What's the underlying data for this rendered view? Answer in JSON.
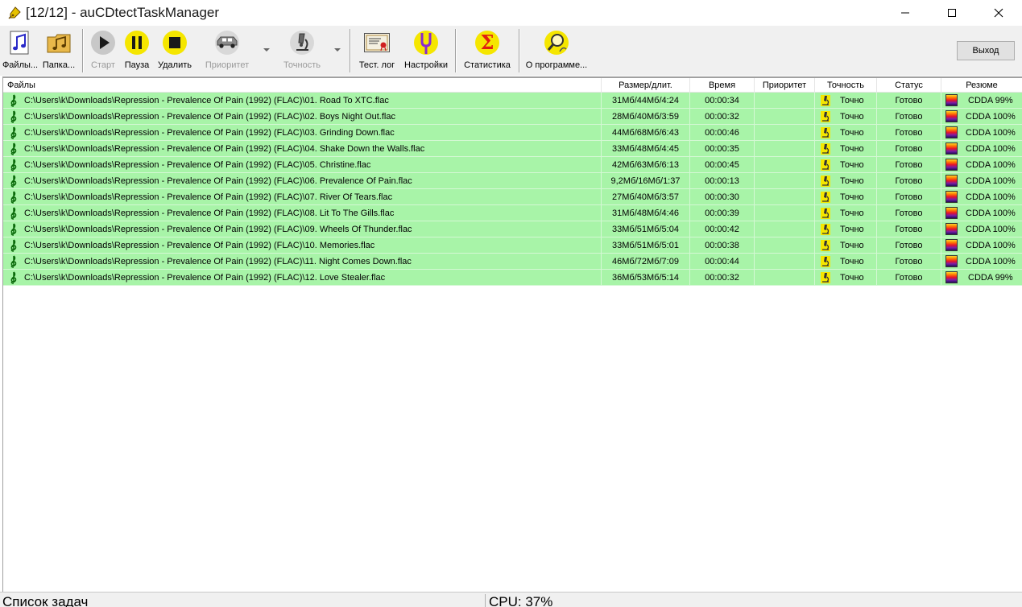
{
  "window": {
    "title": "[12/12] - auCDtectTaskManager"
  },
  "toolbar": {
    "files": "Файлы...",
    "folder": "Папка...",
    "start": "Старт",
    "pause": "Пауза",
    "delete": "Удалить",
    "priority": "Приоритет",
    "accuracy": "Точность",
    "test_log": "Тест. лог",
    "settings": "Настройки",
    "statistics": "Статистика",
    "about": "О программе...",
    "exit": "Выход"
  },
  "columns": {
    "files": "Файлы",
    "size": "Размер/длит.",
    "time": "Время",
    "priority": "Приоритет",
    "accuracy": "Точность",
    "status": "Статус",
    "summary": "Резюме"
  },
  "rows": [
    {
      "file": "C:\\Users\\k\\Downloads\\Repression - Prevalence Of Pain (1992) (FLAC)\\01. Road To XTC.flac",
      "size": "31Мб/44Мб/4:24",
      "time": "00:00:34",
      "priority": "",
      "accuracy": "Точно",
      "status": "Готово",
      "summary": "CDDA 99%"
    },
    {
      "file": "C:\\Users\\k\\Downloads\\Repression - Prevalence Of Pain (1992) (FLAC)\\02. Boys Night Out.flac",
      "size": "28Мб/40Мб/3:59",
      "time": "00:00:32",
      "priority": "",
      "accuracy": "Точно",
      "status": "Готово",
      "summary": "CDDA 100%"
    },
    {
      "file": "C:\\Users\\k\\Downloads\\Repression - Prevalence Of Pain (1992) (FLAC)\\03. Grinding Down.flac",
      "size": "44Мб/68Мб/6:43",
      "time": "00:00:46",
      "priority": "",
      "accuracy": "Точно",
      "status": "Готово",
      "summary": "CDDA 100%"
    },
    {
      "file": "C:\\Users\\k\\Downloads\\Repression - Prevalence Of Pain (1992) (FLAC)\\04. Shake Down the Walls.flac",
      "size": "33Мб/48Мб/4:45",
      "time": "00:00:35",
      "priority": "",
      "accuracy": "Точно",
      "status": "Готово",
      "summary": "CDDA 100%"
    },
    {
      "file": "C:\\Users\\k\\Downloads\\Repression - Prevalence Of Pain (1992) (FLAC)\\05. Christine.flac",
      "size": "42Мб/63Мб/6:13",
      "time": "00:00:45",
      "priority": "",
      "accuracy": "Точно",
      "status": "Готово",
      "summary": "CDDA 100%"
    },
    {
      "file": "C:\\Users\\k\\Downloads\\Repression - Prevalence Of Pain (1992) (FLAC)\\06. Prevalence Of Pain.flac",
      "size": "9,2Мб/16Мб/1:37",
      "time": "00:00:13",
      "priority": "",
      "accuracy": "Точно",
      "status": "Готово",
      "summary": "CDDA 100%"
    },
    {
      "file": "C:\\Users\\k\\Downloads\\Repression - Prevalence Of Pain (1992) (FLAC)\\07. River Of Tears.flac",
      "size": "27Мб/40Мб/3:57",
      "time": "00:00:30",
      "priority": "",
      "accuracy": "Точно",
      "status": "Готово",
      "summary": "CDDA 100%"
    },
    {
      "file": "C:\\Users\\k\\Downloads\\Repression - Prevalence Of Pain (1992) (FLAC)\\08. Lit To The Gills.flac",
      "size": "31Мб/48Мб/4:46",
      "time": "00:00:39",
      "priority": "",
      "accuracy": "Точно",
      "status": "Готово",
      "summary": "CDDA 100%"
    },
    {
      "file": "C:\\Users\\k\\Downloads\\Repression - Prevalence Of Pain (1992) (FLAC)\\09. Wheels Of Thunder.flac",
      "size": "33Мб/51Мб/5:04",
      "time": "00:00:42",
      "priority": "",
      "accuracy": "Точно",
      "status": "Готово",
      "summary": "CDDA 100%"
    },
    {
      "file": "C:\\Users\\k\\Downloads\\Repression - Prevalence Of Pain (1992) (FLAC)\\10. Memories.flac",
      "size": "33Мб/51Мб/5:01",
      "time": "00:00:38",
      "priority": "",
      "accuracy": "Точно",
      "status": "Готово",
      "summary": "CDDA 100%"
    },
    {
      "file": "C:\\Users\\k\\Downloads\\Repression - Prevalence Of Pain (1992) (FLAC)\\11. Night Comes Down.flac",
      "size": "46Мб/72Мб/7:09",
      "time": "00:00:44",
      "priority": "",
      "accuracy": "Точно",
      "status": "Готово",
      "summary": "CDDA 100%"
    },
    {
      "file": "C:\\Users\\k\\Downloads\\Repression - Prevalence Of Pain (1992) (FLAC)\\12. Love Stealer.flac",
      "size": "36Мб/53Мб/5:14",
      "time": "00:00:32",
      "priority": "",
      "accuracy": "Точно",
      "status": "Готово",
      "summary": "CDDA 99%"
    }
  ],
  "statusbar": {
    "left": "Список задач",
    "right": "CPU: 37%"
  },
  "colors": {
    "row_done": "#a8f4a8",
    "toolbar_bg": "#f0f0f0",
    "accent_yellow": "#f5e600"
  },
  "icons": {
    "app": "pen-nib-icon",
    "files": "music-note-doc-icon",
    "folder": "music-folder-icon",
    "start": "play-icon",
    "pause": "pause-icon",
    "delete": "stop-icon",
    "priority": "car-icon",
    "accuracy": "microscope-icon",
    "test_log": "certificate-icon",
    "settings": "tuning-fork-icon",
    "statistics": "sigma-icon",
    "about": "magnifier-icon",
    "row_file": "treble-clef-icon",
    "row_accuracy": "microscope-small-icon",
    "row_summary": "spectrogram-icon"
  }
}
